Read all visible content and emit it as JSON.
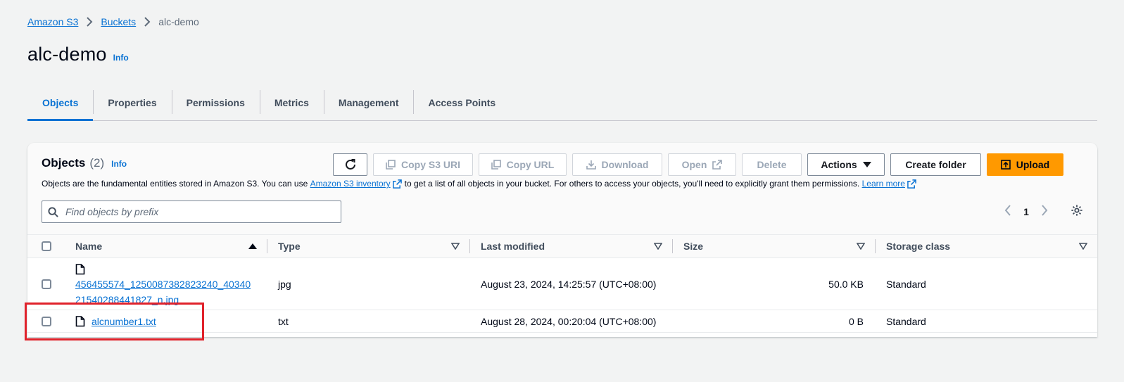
{
  "breadcrumb": {
    "root": "Amazon S3",
    "buckets": "Buckets",
    "current": "alc-demo"
  },
  "header": {
    "title": "alc-demo",
    "info": "Info"
  },
  "tabs": [
    {
      "label": "Objects",
      "active": true
    },
    {
      "label": "Properties"
    },
    {
      "label": "Permissions"
    },
    {
      "label": "Metrics"
    },
    {
      "label": "Management"
    },
    {
      "label": "Access Points"
    }
  ],
  "objects_panel": {
    "title": "Objects",
    "count": "(2)",
    "info": "Info",
    "description_part1": "Objects are the fundamental entities stored in Amazon S3. You can use",
    "inventory_link": "Amazon S3 inventory",
    "description_part2": "to get a list of all objects in your bucket. For others to access your objects, you'll need to explicitly grant them permissions.",
    "learn_more": "Learn more",
    "buttons": {
      "copy_s3_uri": "Copy S3 URI",
      "copy_url": "Copy URL",
      "download": "Download",
      "open": "Open",
      "delete": "Delete",
      "actions": "Actions",
      "create_folder": "Create folder",
      "upload": "Upload"
    },
    "search_placeholder": "Find objects by prefix",
    "page_number": "1"
  },
  "table": {
    "columns": [
      "Name",
      "Type",
      "Last modified",
      "Size",
      "Storage class"
    ],
    "rows": [
      {
        "name_line1": "456455574_1250087382823240_40340",
        "name_line2": "21540288441827_n.jpg",
        "type": "jpg",
        "last_modified": "August 23, 2024, 14:25:57 (UTC+08:00)",
        "size": "50.0 KB",
        "storage_class": "Standard"
      },
      {
        "name": "alcnumber1.txt",
        "type": "txt",
        "last_modified": "August 28, 2024, 00:20:04 (UTC+08:00)",
        "size": "0 B",
        "storage_class": "Standard"
      }
    ]
  },
  "colors": {
    "link": "#0972d3",
    "upload": "#ff9900",
    "highlight": "#e0222b"
  }
}
